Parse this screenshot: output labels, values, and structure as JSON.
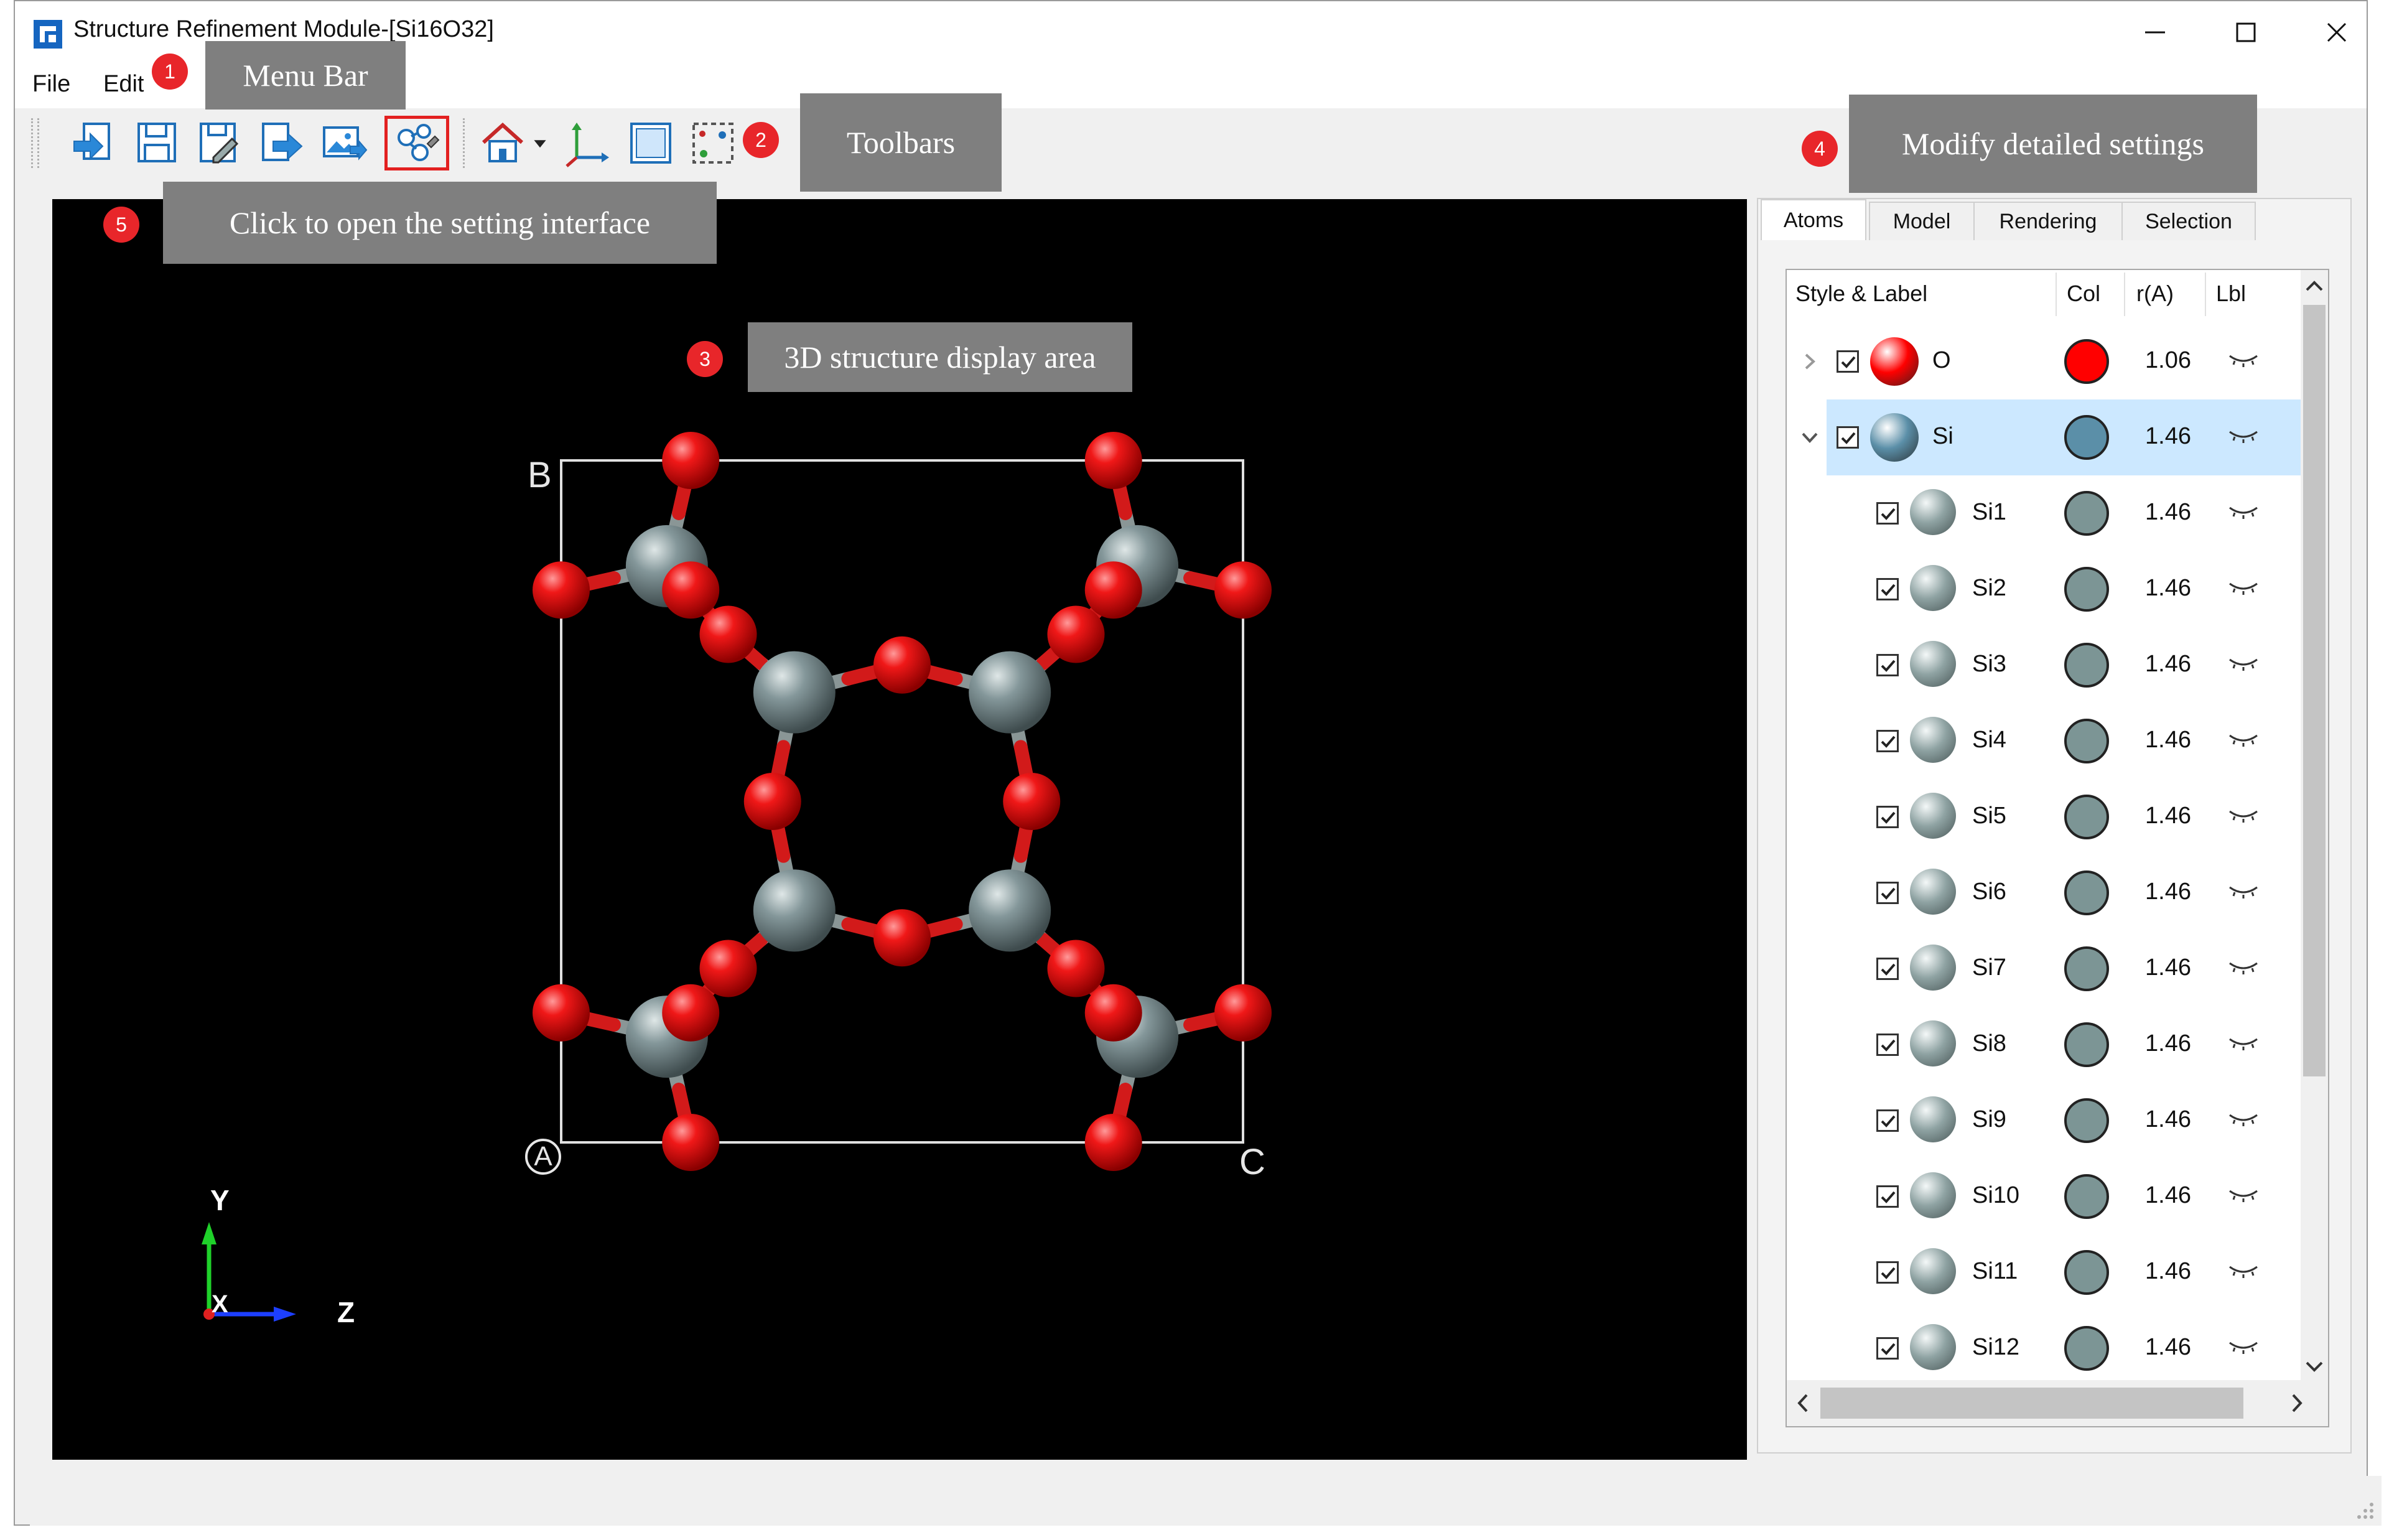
{
  "window": {
    "title": "Structure Refinement Module-[Si16O32]",
    "minimize_icon": "minimize-icon",
    "maximize_icon": "maximize-icon",
    "close_icon": "close-icon"
  },
  "menubar": {
    "items": [
      {
        "label": "File"
      },
      {
        "label": "Edit"
      }
    ]
  },
  "toolbar": {
    "icons": [
      "import-icon",
      "save-icon",
      "save-as-icon",
      "export-icon",
      "export-image-icon",
      "settings-icon",
      "home-view-icon",
      "dropdown-arrow-icon",
      "axes-icon",
      "box-view-icon",
      "select-region-icon"
    ]
  },
  "viewport": {
    "cell_labels": {
      "b": "B",
      "a": "A",
      "c": "C"
    },
    "axes": {
      "y": "Y",
      "x": "X",
      "z": "Z"
    },
    "colors": {
      "oxygen": "#e8121b",
      "silicon": "#7c8e8e",
      "bond_red": "#d21a1a",
      "bond_grey": "#8a9696",
      "cell": "#e0e0e0"
    }
  },
  "panel": {
    "tabs": [
      {
        "label": "Atoms",
        "active": true
      },
      {
        "label": "Model",
        "active": false
      },
      {
        "label": "Rendering",
        "active": false
      },
      {
        "label": "Selection",
        "active": false
      }
    ],
    "columns": {
      "style_label": "Style & Label",
      "col": "Col",
      "radius": "r(A)",
      "lbl": "Lbl"
    },
    "rows": [
      {
        "name": "O",
        "radius": "1.06",
        "color": "#ff0000",
        "level": 0,
        "expanded": false,
        "checked": true
      },
      {
        "name": "Si",
        "radius": "1.46",
        "color": "#5b8fa8",
        "level": 0,
        "expanded": true,
        "checked": true,
        "selected": true
      },
      {
        "name": "Si1",
        "radius": "1.46",
        "color": "#7c9595",
        "level": 1,
        "checked": true
      },
      {
        "name": "Si2",
        "radius": "1.46",
        "color": "#7c9595",
        "level": 1,
        "checked": true
      },
      {
        "name": "Si3",
        "radius": "1.46",
        "color": "#7c9595",
        "level": 1,
        "checked": true
      },
      {
        "name": "Si4",
        "radius": "1.46",
        "color": "#7c9595",
        "level": 1,
        "checked": true
      },
      {
        "name": "Si5",
        "radius": "1.46",
        "color": "#7c9595",
        "level": 1,
        "checked": true
      },
      {
        "name": "Si6",
        "radius": "1.46",
        "color": "#7c9595",
        "level": 1,
        "checked": true
      },
      {
        "name": "Si7",
        "radius": "1.46",
        "color": "#7c9595",
        "level": 1,
        "checked": true
      },
      {
        "name": "Si8",
        "radius": "1.46",
        "color": "#7c9595",
        "level": 1,
        "checked": true
      },
      {
        "name": "Si9",
        "radius": "1.46",
        "color": "#7c9595",
        "level": 1,
        "checked": true
      },
      {
        "name": "Si10",
        "radius": "1.46",
        "color": "#7c9595",
        "level": 1,
        "checked": true
      },
      {
        "name": "Si11",
        "radius": "1.46",
        "color": "#7c9595",
        "level": 1,
        "checked": true
      },
      {
        "name": "Si12",
        "radius": "1.46",
        "color": "#7c9595",
        "level": 1,
        "checked": true
      }
    ]
  },
  "annotations": [
    {
      "number": "1",
      "text": "Menu Bar"
    },
    {
      "number": "2",
      "text": "Toolbars"
    },
    {
      "number": "3",
      "text": "3D structure display area"
    },
    {
      "number": "4",
      "text": "Modify detailed settings"
    },
    {
      "number": "5",
      "text": "Click to open the setting interface"
    }
  ]
}
